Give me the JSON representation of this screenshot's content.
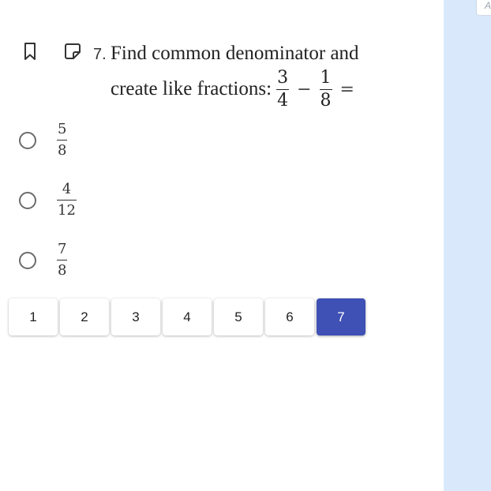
{
  "question": {
    "number": "7.",
    "line1": "Find common denominator and",
    "line2_text": "create like fractions:",
    "expression": {
      "left": {
        "numerator": "3",
        "denominator": "4"
      },
      "operator": "−",
      "right": {
        "numerator": "1",
        "denominator": "8"
      },
      "equals": "="
    }
  },
  "options": [
    {
      "numerator": "5",
      "denominator": "8"
    },
    {
      "numerator": "4",
      "denominator": "12"
    },
    {
      "numerator": "7",
      "denominator": "8"
    }
  ],
  "pagination": {
    "pages": [
      "1",
      "2",
      "3",
      "4",
      "5",
      "6",
      "7"
    ],
    "active": "7"
  },
  "side_tab": {
    "label": "A"
  },
  "colors": {
    "accent": "#3f51b5",
    "side_panel": "#d9e9fb"
  },
  "icons": {
    "bookmark": "bookmark-icon",
    "note": "note-icon"
  }
}
